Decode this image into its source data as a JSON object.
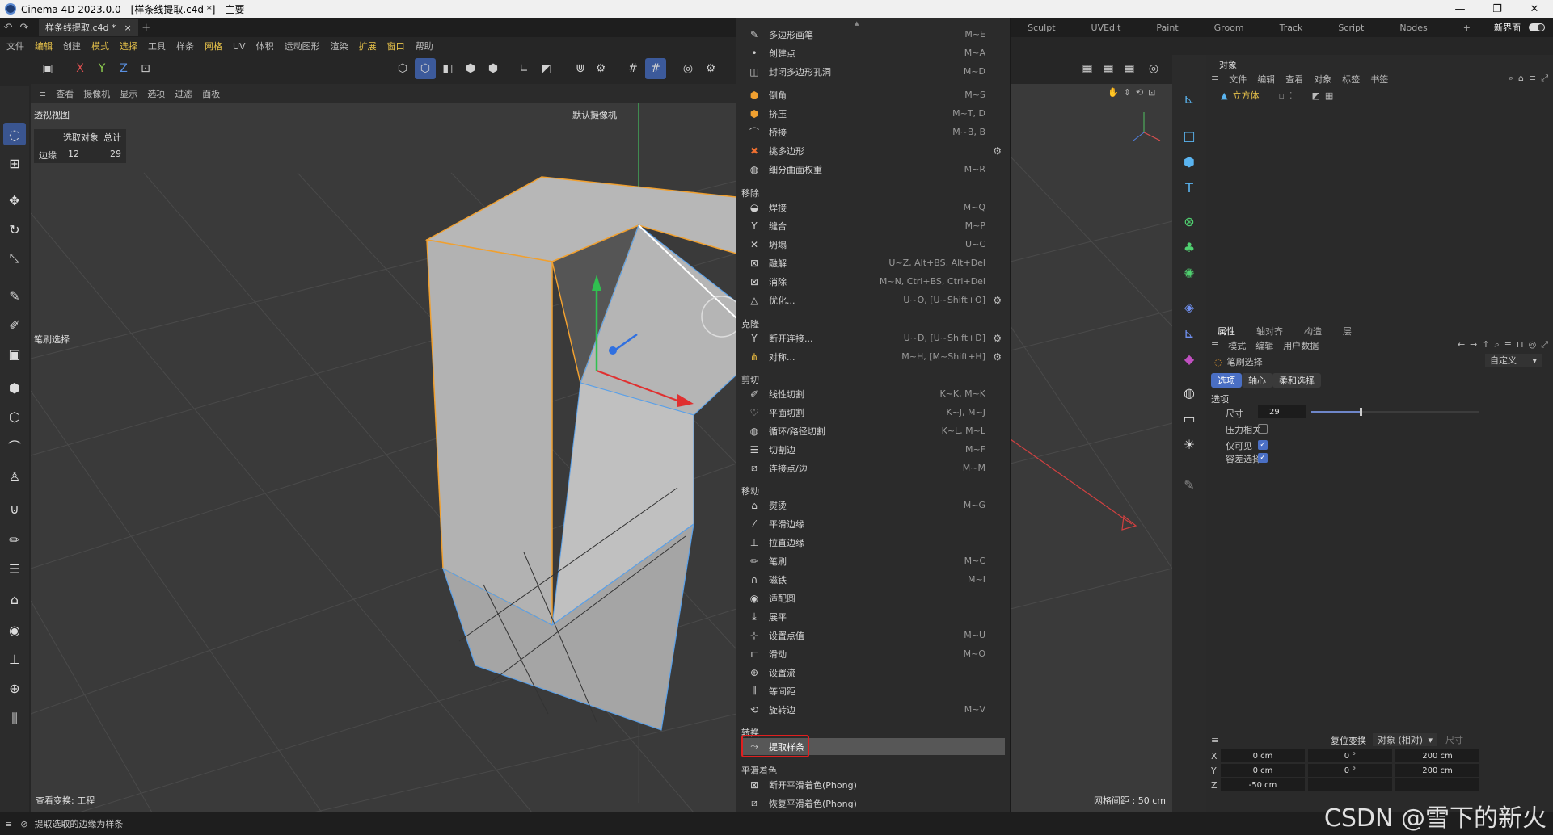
{
  "window": {
    "title": "Cinema 4D 2023.0.0 - [样条线提取.c4d *] - 主要",
    "controls": [
      "—",
      "❐",
      "✕"
    ]
  },
  "tabs": {
    "document": "样条线提取.c4d *",
    "close": "×",
    "add": "+",
    "workspaces": [
      "Sculpt",
      "UVEdit",
      "Paint",
      "Groom",
      "Track",
      "Script",
      "Nodes"
    ],
    "new_ui_label": "新界面"
  },
  "menubar": [
    "文件",
    "编辑",
    "创建",
    "模式",
    "选择",
    "工具",
    "样条",
    "网格",
    "UV",
    "体积",
    "运动图形",
    "渲染",
    "扩展",
    "窗口",
    "帮助"
  ],
  "menubar_highlight": [
    "编辑",
    "模式",
    "选择",
    "网格",
    "扩展",
    "窗口"
  ],
  "toolbar": {
    "axes": [
      "X",
      "Y",
      "Z"
    ]
  },
  "viewport": {
    "menu": [
      "查看",
      "摄像机",
      "显示",
      "选项",
      "过滤",
      "面板"
    ],
    "view_name": "透视视图",
    "camera_label": "默认摄像机",
    "stats_headers": [
      "选取对象",
      "总计"
    ],
    "stats_row": {
      "label": "边缘",
      "selected": "12",
      "total": "29"
    },
    "tool_hint": "笔刷选择",
    "bottom_left": "查看变换: 工程",
    "bottom_right": "网格间距 : 50 cm"
  },
  "popup_menu": {
    "sections": [
      {
        "title": "",
        "items": [
          {
            "icon": "pen-icon",
            "label": "多边形画笔",
            "shortcut": "M~E"
          },
          {
            "icon": "point-icon",
            "label": "创建点",
            "shortcut": "M~A"
          },
          {
            "icon": "close-hole-icon",
            "label": "封闭多边形孔洞",
            "shortcut": "M~D"
          },
          {
            "icon": "bevel-icon",
            "label": "倒角",
            "shortcut": "M~S"
          },
          {
            "icon": "extrude-icon",
            "label": "挤压",
            "shortcut": "M~T, D"
          },
          {
            "icon": "bridge-icon",
            "label": "桥接",
            "shortcut": "M~B, B"
          },
          {
            "icon": "poke-icon",
            "label": "挑多边形",
            "shortcut": "",
            "gear": true
          },
          {
            "icon": "weight-icon",
            "label": "细分曲面权重",
            "shortcut": "M~R"
          }
        ]
      },
      {
        "title": "移除",
        "items": [
          {
            "icon": "weld-icon",
            "label": "焊接",
            "shortcut": "M~Q"
          },
          {
            "icon": "stitch-icon",
            "label": "缝合",
            "shortcut": "M~P"
          },
          {
            "icon": "collapse-icon",
            "label": "坍塌",
            "shortcut": "U~C"
          },
          {
            "icon": "dissolve-icon",
            "label": "融解",
            "shortcut": "U~Z, Alt+BS, Alt+Del"
          },
          {
            "icon": "delete-icon",
            "label": "消除",
            "shortcut": "M~N, Ctrl+BS, Ctrl+Del"
          },
          {
            "icon": "optimize-icon",
            "label": "优化...",
            "shortcut": "U~O, [U~Shift+O]",
            "gear": true
          }
        ]
      },
      {
        "title": "克隆",
        "items": [
          {
            "icon": "disconnect-icon",
            "label": "断开连接...",
            "shortcut": "U~D, [U~Shift+D]",
            "gear": true
          },
          {
            "icon": "mirror-icon",
            "label": "对称...",
            "shortcut": "M~H, [M~Shift+H]",
            "gear": true
          }
        ]
      },
      {
        "title": "剪切",
        "items": [
          {
            "icon": "knife-line-icon",
            "label": "线性切割",
            "shortcut": "K~K, M~K"
          },
          {
            "icon": "knife-plane-icon",
            "label": "平面切割",
            "shortcut": "K~J, M~J"
          },
          {
            "icon": "knife-loop-icon",
            "label": "循环/路径切割",
            "shortcut": "K~L, M~L"
          },
          {
            "icon": "edge-cut-icon",
            "label": "切割边",
            "shortcut": "M~F"
          },
          {
            "icon": "connect-icon",
            "label": "连接点/边",
            "shortcut": "M~M"
          }
        ]
      },
      {
        "title": "移动",
        "items": [
          {
            "icon": "iron-icon",
            "label": "熨烫",
            "shortcut": "M~G"
          },
          {
            "icon": "smooth-shift-icon",
            "label": "平滑边缘",
            "shortcut": ""
          },
          {
            "icon": "straighten-icon",
            "label": "拉直边缘",
            "shortcut": ""
          },
          {
            "icon": "brush-icon",
            "label": "笔刷",
            "shortcut": "M~C"
          },
          {
            "icon": "magnet-icon",
            "label": "磁铁",
            "shortcut": "M~I"
          },
          {
            "icon": "fit-circle-icon",
            "label": "适配圆",
            "shortcut": ""
          },
          {
            "icon": "flatten-icon",
            "label": "展平",
            "shortcut": ""
          },
          {
            "icon": "set-value-icon",
            "label": "设置点值",
            "shortcut": "M~U"
          },
          {
            "icon": "slide-icon",
            "label": "滑动",
            "shortcut": "M~O"
          },
          {
            "icon": "set-flow-icon",
            "label": "设置流",
            "shortcut": ""
          },
          {
            "icon": "equal-spacing-icon",
            "label": "等间距",
            "shortcut": ""
          },
          {
            "icon": "spin-edge-icon",
            "label": "旋转边",
            "shortcut": "M~V"
          }
        ]
      },
      {
        "title": "转换",
        "items": [
          {
            "icon": "edge-to-spline-icon",
            "label": "提取样条",
            "shortcut": "",
            "active": true
          }
        ]
      },
      {
        "title": "平滑着色",
        "items": [
          {
            "icon": "break-phong-icon",
            "label": "断开平滑着色(Phong)",
            "shortcut": ""
          },
          {
            "icon": "unbreak-phong-icon",
            "label": "恢复平滑着色(Phong)",
            "shortcut": ""
          }
        ]
      }
    ]
  },
  "object_panel": {
    "tab": "对象",
    "menu": [
      "文件",
      "编辑",
      "查看",
      "对象",
      "标签",
      "书签"
    ],
    "object_name": "立方体"
  },
  "attribute_panel": {
    "tabs": [
      "属性",
      "轴对齐",
      "构造",
      "层"
    ],
    "menu": [
      "模式",
      "编辑",
      "用户数据"
    ],
    "tool_name": "笔刷选择",
    "preset": "自定义",
    "subtabs": [
      "选项",
      "轴心",
      "柔和选择"
    ],
    "section": "选项",
    "size_label": "尺寸",
    "size_value": "29",
    "size_slider_fraction": 0.29,
    "pressure_label": "压力相关",
    "pressure_checked": false,
    "visible_only_label": "仅可见",
    "visible_only_checked": true,
    "tolerant_label": "容差选择",
    "tolerant_checked": true
  },
  "coord_panel": {
    "reset_label": "复位变换",
    "mode_label": "对象 (相对)",
    "size_label": "尺寸",
    "rows": [
      {
        "axis": "X",
        "pos": "0 cm",
        "rot": "0 °",
        "size": "200 cm"
      },
      {
        "axis": "Y",
        "pos": "0 cm",
        "rot": "0 °",
        "size": "200 cm"
      },
      {
        "axis": "Z",
        "pos": "-50 cm",
        "rot": "",
        "size": ""
      }
    ]
  },
  "statusbar": {
    "text": "提取选取的边缘为样条"
  },
  "watermark": "CSDN @雪下的新火",
  "colors": {
    "accent": "#3c5a9b",
    "highlight_menu": "#e8c34a",
    "red_box": "#e02020",
    "edge_orange": "#f0a030"
  }
}
